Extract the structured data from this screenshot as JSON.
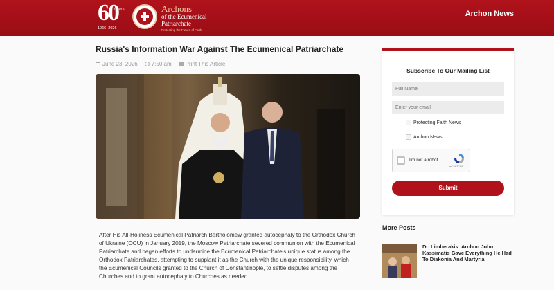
{
  "header": {
    "logo60": {
      "number": "60",
      "years_label": "YEARS",
      "range": "1966–2026"
    },
    "logo": {
      "line1": "Archons",
      "line2": "of the Ecumenical",
      "line3": "Patriarchate",
      "tagline": "Protecting the Future of Faith"
    },
    "nav_link": "Archon News"
  },
  "article": {
    "title": "Russia's Information War Against The Ecumenical Patriarchate",
    "date": "June 23, 2026",
    "time": "7:50 am",
    "print_label": "Print This Article",
    "hero_alt": "Patriarch and president walking",
    "body": "After His All-Holiness Ecumenical Patriarch Bartholomew granted autocephaly to the Orthodox Church of Ukraine (OCU) in January 2019, the Moscow Patriarchate severed communion with the Ecumenical Patriarchate and began efforts to undermine the Ecumenical Patriarchate's unique status among the Orthodox Patriarchates, attempting to supplant it as the Church with the unique responsibility, which the Ecumenical Councils granted to the Church of Constantinople, to settle disputes among the Churches and to grant autocephaly to Churches as needed."
  },
  "sidebar": {
    "heading": "Subscribe To Our Mailing List",
    "fullname_placeholder": "Full Name",
    "email_placeholder": "Enter your email",
    "lists": [
      "Protecting Faith News",
      "Archon News"
    ],
    "captcha_label": "I'm not a robot",
    "captcha_brand": "reCAPTCHA",
    "submit_label": "Submit",
    "more_posts_heading": "More Posts",
    "posts": [
      {
        "title": "Dr. Limberakis: Archon John Kassimatis Gave Everything He Had To Diakonia And Martyria"
      }
    ]
  },
  "colors": {
    "brand": "#b0121b",
    "gold": "#f1c9a0"
  }
}
